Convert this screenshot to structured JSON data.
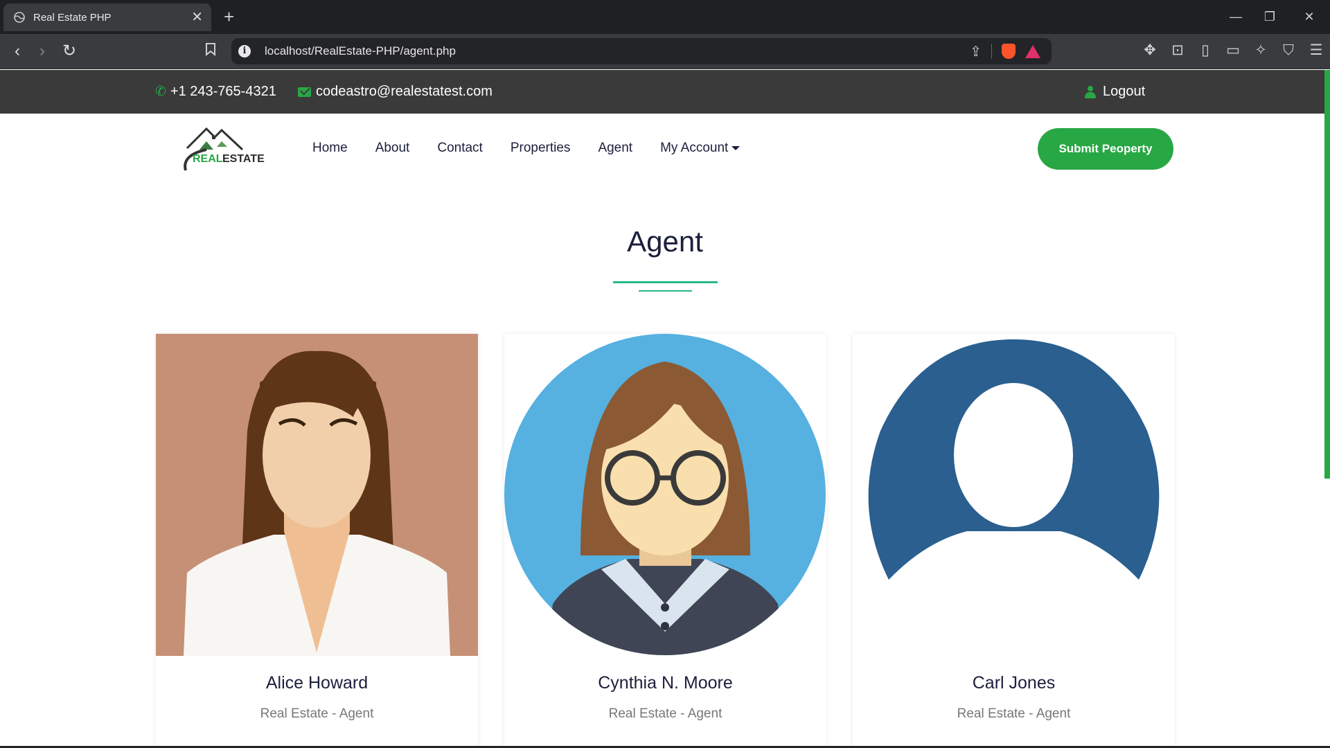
{
  "browser": {
    "tab_title": "Real Estate PHP",
    "tab_close": "✕",
    "new_tab": "+",
    "url": "localhost/RealEstate-PHP/agent.php",
    "window_controls": [
      "—",
      "❐",
      "✕"
    ]
  },
  "topbar": {
    "phone": "+1 243-765-4321",
    "email": "codeastro@realestatest.com",
    "logout": "Logout"
  },
  "header": {
    "logo_text_green": "REAL",
    "logo_text_dark": "ESTATE",
    "nav": [
      "Home",
      "About",
      "Contact",
      "Properties",
      "Agent",
      "My Account"
    ],
    "submit_label": "Submit Peoperty"
  },
  "main": {
    "title": "Agent",
    "agents": [
      {
        "name": "Alice Howard",
        "role": "Real Estate - Agent"
      },
      {
        "name": "Cynthia N. Moore",
        "role": "Real Estate - Agent"
      },
      {
        "name": "Carl Jones",
        "role": "Real Estate - Agent"
      }
    ]
  },
  "colors": {
    "accent": "#28a745",
    "topbar": "#3a3a3a",
    "title": "#1b1f3b",
    "divider": "#28b78c"
  }
}
